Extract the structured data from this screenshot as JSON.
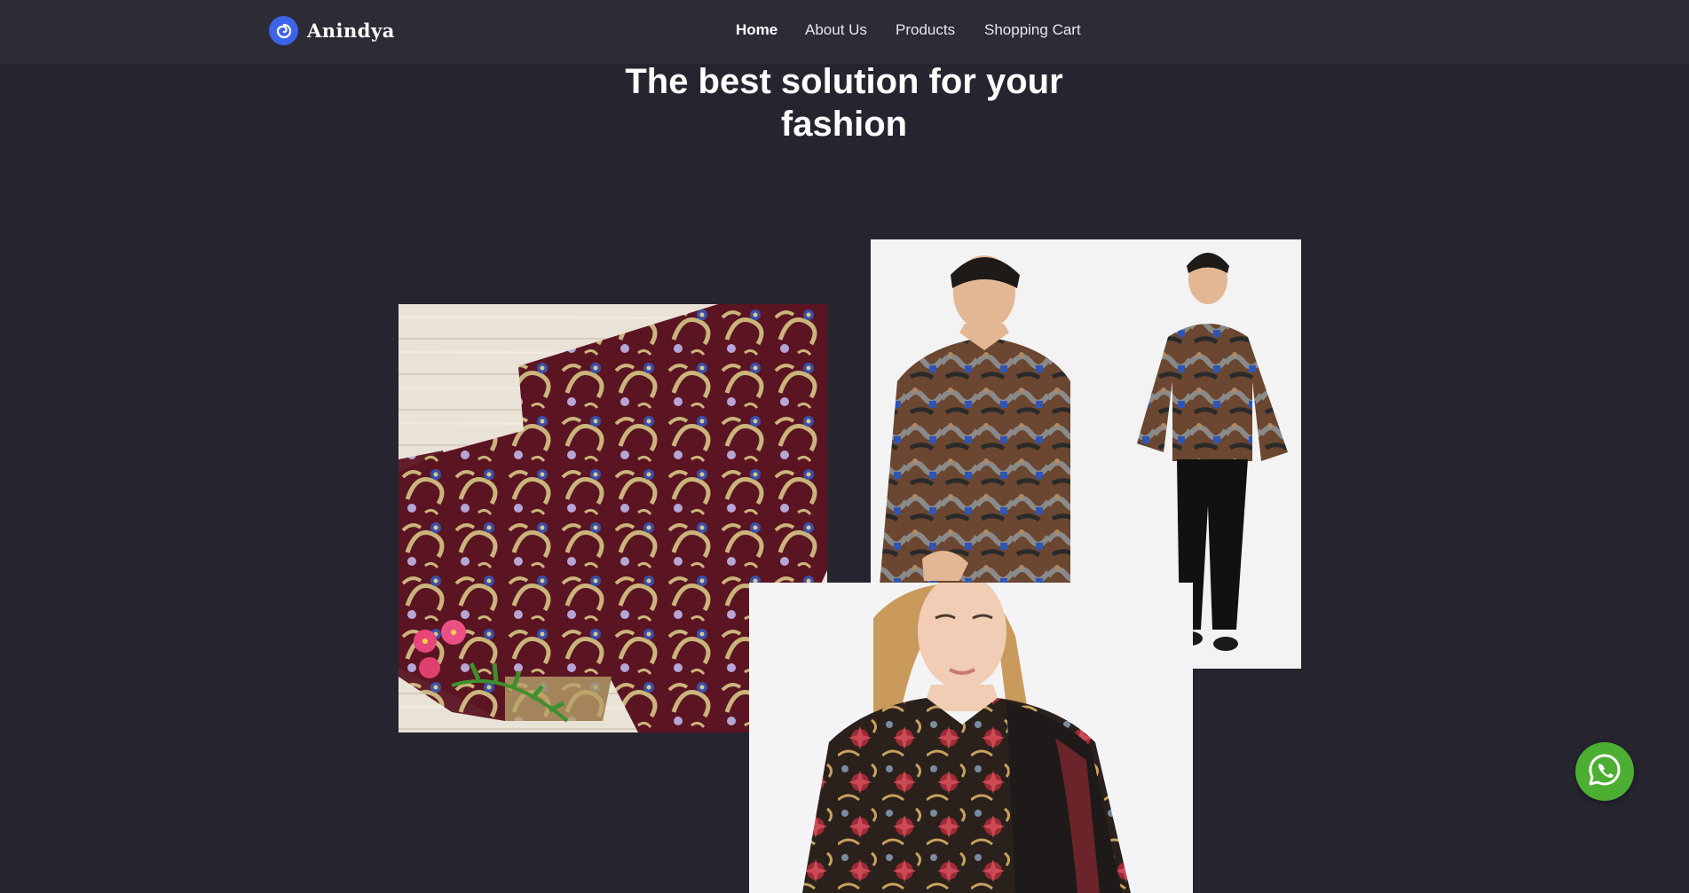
{
  "header": {
    "brand_name": "Anindya",
    "logo_icon": "swirl-logo-icon",
    "nav": [
      {
        "label": "Home",
        "active": true
      },
      {
        "label": "About Us",
        "active": false
      },
      {
        "label": "Products",
        "active": false
      },
      {
        "label": "Shopping Cart",
        "active": false
      }
    ]
  },
  "hero": {
    "title_line1": "The best solution for your",
    "title_line2": "fashion"
  },
  "gallery": [
    {
      "name": "batik-fabric-image",
      "subject": "maroon batik fabric with flowers"
    },
    {
      "name": "men-batik-shirt-image",
      "subject": "man in batik shirt"
    },
    {
      "name": "women-batik-blouse-image",
      "subject": "woman in batik blouse"
    }
  ],
  "floating": {
    "whatsapp_icon": "whatsapp-icon"
  },
  "colors": {
    "background": "#25242f",
    "navbar": "#2c2b36",
    "logo": "#3d63e8",
    "whatsapp": "#4caf33"
  }
}
